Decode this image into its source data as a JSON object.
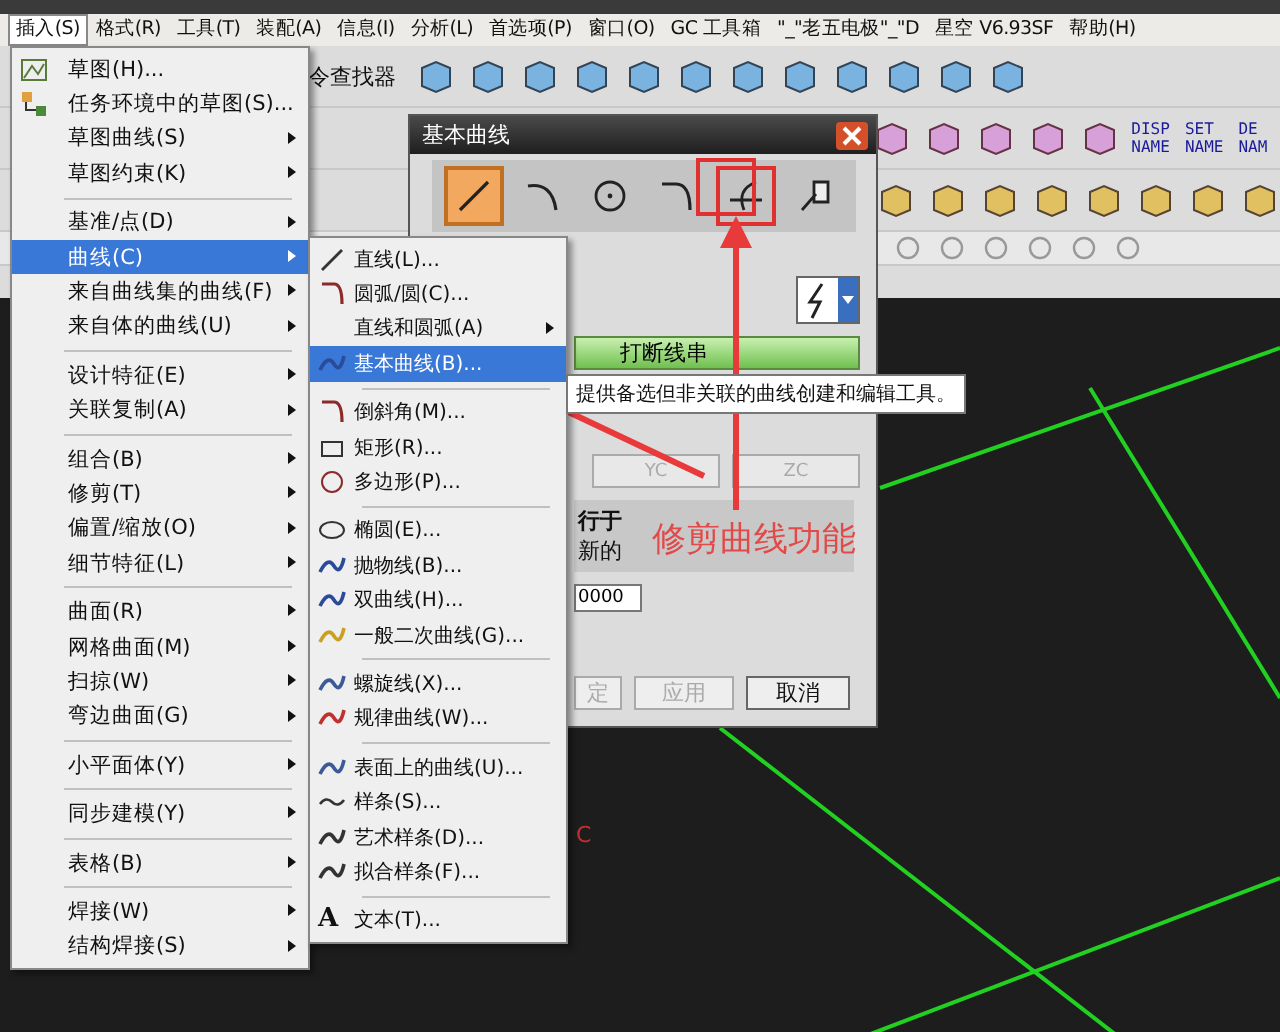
{
  "menubar": [
    {
      "label": "插入(S)",
      "selected": true
    },
    {
      "label": "格式(R)",
      "selected": false
    },
    {
      "label": "工具(T)",
      "selected": false
    },
    {
      "label": "装配(A)",
      "selected": false
    },
    {
      "label": "信息(I)",
      "selected": false
    },
    {
      "label": "分析(L)",
      "selected": false
    },
    {
      "label": "首选项(P)",
      "selected": false
    },
    {
      "label": "窗口(O)",
      "selected": false
    },
    {
      "label": "GC 工具箱",
      "selected": false
    },
    {
      "label": "\"_\"老五电极\"_\"D",
      "selected": false
    },
    {
      "label": "星空 V6.93SF",
      "selected": false
    },
    {
      "label": "帮助(H)",
      "selected": false
    }
  ],
  "toolbar": {
    "finder_label": "令查找器",
    "name_buttons": [
      {
        "label": "DISP NAME"
      },
      {
        "label": "SET NAME"
      },
      {
        "label": "DE NAM"
      }
    ]
  },
  "insert_menu": {
    "groups": [
      [
        {
          "label": "草图(H)...",
          "submenu": false,
          "selected": false
        },
        {
          "label": "任务环境中的草图(S)...",
          "submenu": false,
          "selected": false
        },
        {
          "label": "草图曲线(S)",
          "submenu": true,
          "selected": false
        },
        {
          "label": "草图约束(K)",
          "submenu": true,
          "selected": false
        }
      ],
      [
        {
          "label": "基准/点(D)",
          "submenu": true,
          "selected": false
        },
        {
          "label": "曲线(C)",
          "submenu": true,
          "selected": true
        },
        {
          "label": "来自曲线集的曲线(F)",
          "submenu": true,
          "selected": false
        },
        {
          "label": "来自体的曲线(U)",
          "submenu": true,
          "selected": false
        }
      ],
      [
        {
          "label": "设计特征(E)",
          "submenu": true,
          "selected": false
        },
        {
          "label": "关联复制(A)",
          "submenu": true,
          "selected": false
        }
      ],
      [
        {
          "label": "组合(B)",
          "submenu": true,
          "selected": false
        },
        {
          "label": "修剪(T)",
          "submenu": true,
          "selected": false
        },
        {
          "label": "偏置/缩放(O)",
          "submenu": true,
          "selected": false
        },
        {
          "label": "细节特征(L)",
          "submenu": true,
          "selected": false
        }
      ],
      [
        {
          "label": "曲面(R)",
          "submenu": true,
          "selected": false
        },
        {
          "label": "网格曲面(M)",
          "submenu": true,
          "selected": false
        },
        {
          "label": "扫掠(W)",
          "submenu": true,
          "selected": false
        },
        {
          "label": "弯边曲面(G)",
          "submenu": true,
          "selected": false
        }
      ],
      [
        {
          "label": "小平面体(Y)",
          "submenu": true,
          "selected": false
        }
      ],
      [
        {
          "label": "同步建模(Y)",
          "submenu": true,
          "selected": false
        }
      ],
      [
        {
          "label": "表格(B)",
          "submenu": true,
          "selected": false
        }
      ],
      [
        {
          "label": "焊接(W)",
          "submenu": true,
          "selected": false
        },
        {
          "label": "结构焊接(S)",
          "submenu": true,
          "selected": false
        }
      ]
    ]
  },
  "curve_menu": {
    "groups": [
      [
        {
          "label": "直线(L)...",
          "submenu": false,
          "selected": false
        },
        {
          "label": "圆弧/圆(C)...",
          "submenu": false,
          "selected": false
        },
        {
          "label": "直线和圆弧(A)",
          "submenu": true,
          "selected": false
        },
        {
          "label": "基本曲线(B)...",
          "submenu": false,
          "selected": true
        }
      ],
      [
        {
          "label": "倒斜角(M)...",
          "submenu": false,
          "selected": false
        },
        {
          "label": "矩形(R)...",
          "submenu": false,
          "selected": false
        },
        {
          "label": "多边形(P)...",
          "submenu": false,
          "selected": false
        }
      ],
      [
        {
          "label": "椭圆(E)...",
          "submenu": false,
          "selected": false
        },
        {
          "label": "抛物线(B)...",
          "submenu": false,
          "selected": false
        },
        {
          "label": "双曲线(H)...",
          "submenu": false,
          "selected": false
        },
        {
          "label": "一般二次曲线(G)...",
          "submenu": false,
          "selected": false
        }
      ],
      [
        {
          "label": "螺旋线(X)...",
          "submenu": false,
          "selected": false
        },
        {
          "label": "规律曲线(W)...",
          "submenu": false,
          "selected": false
        }
      ],
      [
        {
          "label": "表面上的曲线(U)...",
          "submenu": false,
          "selected": false
        },
        {
          "label": "样条(S)...",
          "submenu": false,
          "selected": false
        },
        {
          "label": "艺术样条(D)...",
          "submenu": false,
          "selected": false
        },
        {
          "label": "拟合样条(F)...",
          "submenu": false,
          "selected": false
        }
      ],
      [
        {
          "label": "文本(T)...",
          "glyph": "A",
          "submenu": false,
          "selected": false
        }
      ]
    ]
  },
  "dialog": {
    "title": "基本曲线",
    "tools": [
      {
        "kind": "line",
        "selected": true,
        "highlighted": false
      },
      {
        "kind": "arc",
        "selected": false,
        "highlighted": false
      },
      {
        "kind": "circle",
        "selected": false,
        "highlighted": false
      },
      {
        "kind": "fillet",
        "selected": false,
        "highlighted": false
      },
      {
        "kind": "trim",
        "selected": false,
        "highlighted": true
      },
      {
        "kind": "edit",
        "selected": false,
        "highlighted": false
      }
    ],
    "break_button": "打断线串",
    "axis_buttons": [
      {
        "label": "YC",
        "disabled": true
      },
      {
        "label": "ZC",
        "disabled": true
      }
    ],
    "parallel_label": "行于",
    "option_label": "新的",
    "value": "0000",
    "buttons": [
      {
        "label": "定",
        "disabled": true
      },
      {
        "label": "应用",
        "disabled": true
      },
      {
        "label": "取消",
        "disabled": false
      }
    ]
  },
  "tooltip": "提供备选但非关联的曲线创建和编辑工具。",
  "annotation": "修剪曲线功能",
  "canvas_label": "C"
}
